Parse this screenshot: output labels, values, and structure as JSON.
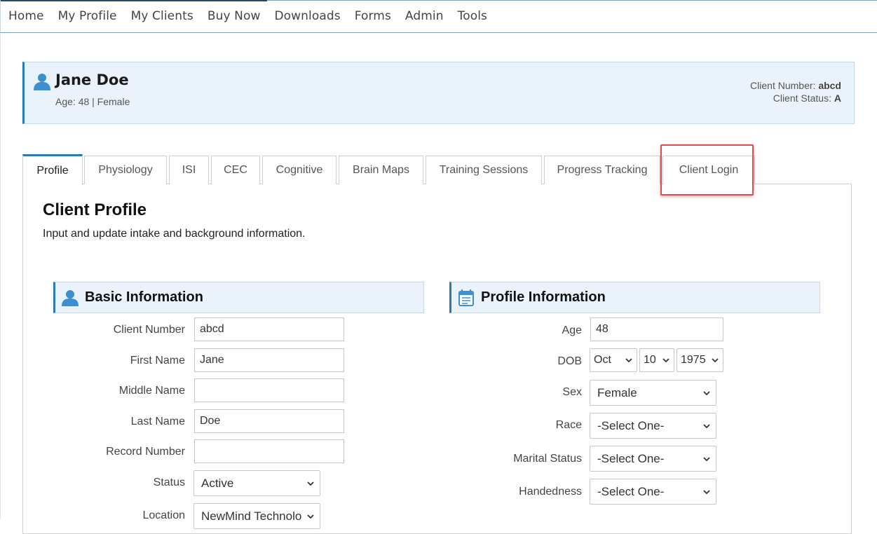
{
  "nav": {
    "items": [
      "Home",
      "My Profile",
      "My Clients",
      "Buy Now",
      "Downloads",
      "Forms",
      "Admin",
      "Tools"
    ]
  },
  "client": {
    "name": "Jane Doe",
    "meta": "Age: 48 | Female",
    "number_label": "Client Number:",
    "number_value": "abcd",
    "status_label": "Client Status:",
    "status_value": "A"
  },
  "tabs": [
    "Profile",
    "Physiology",
    "ISI",
    "CEC",
    "Cognitive",
    "Brain Maps",
    "Training Sessions",
    "Progress Tracking",
    "Client Login"
  ],
  "active_tab": "Profile",
  "highlighted_tab": "Client Login",
  "panel": {
    "title": "Client Profile",
    "description": "Input and update intake and background information."
  },
  "basic": {
    "title": "Basic Information",
    "fields": {
      "client_number": {
        "label": "Client Number",
        "value": "abcd"
      },
      "first_name": {
        "label": "First Name",
        "value": "Jane"
      },
      "middle_name": {
        "label": "Middle Name",
        "value": ""
      },
      "last_name": {
        "label": "Last Name",
        "value": "Doe"
      },
      "record_number": {
        "label": "Record Number",
        "value": ""
      },
      "status": {
        "label": "Status",
        "value": "Active"
      },
      "location": {
        "label": "Location",
        "value": "NewMind Technolo"
      }
    }
  },
  "profile": {
    "title": "Profile Information",
    "fields": {
      "age": {
        "label": "Age",
        "value": "48"
      },
      "dob": {
        "label": "DOB",
        "month": "Oct",
        "day": "10",
        "year": "1975"
      },
      "sex": {
        "label": "Sex",
        "value": "Female"
      },
      "race": {
        "label": "Race",
        "value": "-Select One-"
      },
      "marital": {
        "label": "Marital Status",
        "value": "-Select One-"
      },
      "handedness": {
        "label": "Handedness",
        "value": "-Select One-"
      }
    }
  },
  "colors": {
    "accent": "#2a7ab8",
    "header_bg": "#eaf3fb",
    "highlight": "#e04b4b",
    "nav_border": "#7aa3c4"
  }
}
